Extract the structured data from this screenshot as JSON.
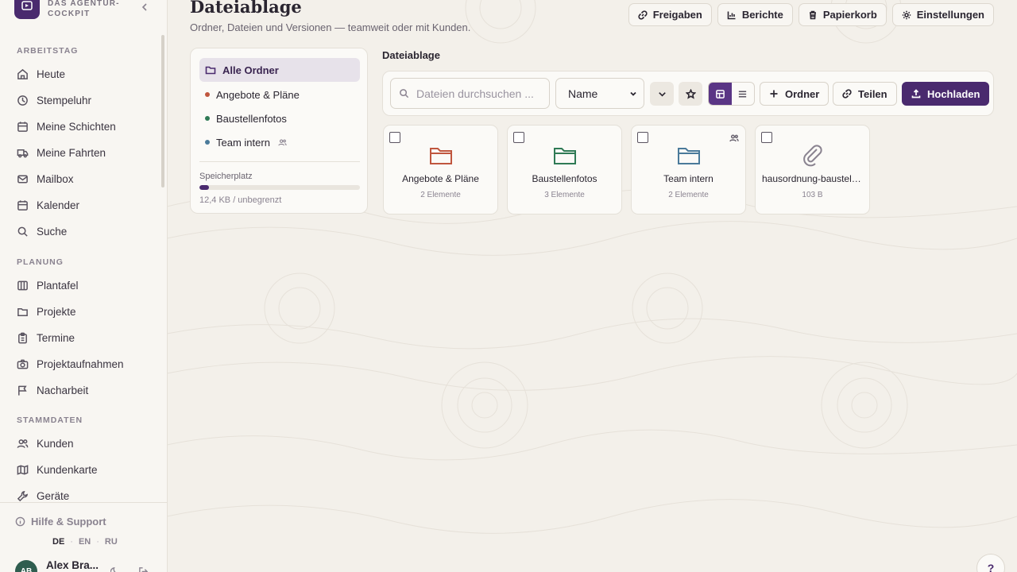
{
  "brand": {
    "tagline": "DAS AGENTUR-COCKPIT"
  },
  "sidebar": {
    "sections": [
      {
        "title": "ARBEITSTAG",
        "items": [
          {
            "label": "Heute",
            "icon": "home-icon"
          },
          {
            "label": "Stempeluhr",
            "icon": "clock-icon"
          },
          {
            "label": "Meine Schichten",
            "icon": "calendar-icon"
          },
          {
            "label": "Meine Fahrten",
            "icon": "truck-icon"
          },
          {
            "label": "Mailbox",
            "icon": "mail-icon"
          },
          {
            "label": "Kalender",
            "icon": "calendar-icon"
          },
          {
            "label": "Suche",
            "icon": "search-icon"
          }
        ]
      },
      {
        "title": "PLANUNG",
        "items": [
          {
            "label": "Plantafel",
            "icon": "board-icon"
          },
          {
            "label": "Projekte",
            "icon": "folder-icon"
          },
          {
            "label": "Termine",
            "icon": "clipboard-icon"
          },
          {
            "label": "Projektaufnahmen",
            "icon": "camera-icon"
          },
          {
            "label": "Nacharbeit",
            "icon": "flag-icon"
          }
        ]
      },
      {
        "title": "STAMMDATEN",
        "items": [
          {
            "label": "Kunden",
            "icon": "users-icon"
          },
          {
            "label": "Kundenkarte",
            "icon": "map-icon"
          },
          {
            "label": "Geräte",
            "icon": "wrench-icon"
          }
        ]
      }
    ],
    "help": "Hilfe & Support",
    "languages": [
      "DE",
      "EN",
      "RU"
    ],
    "active_language": "DE",
    "user": {
      "initials": "AB",
      "name": "Alex Bra..."
    }
  },
  "header": {
    "title": "Dateiablage",
    "subtitle": "Ordner, Dateien und Versionen — teamweit oder mit Kunden.",
    "actions": [
      "Freigaben",
      "Berichte",
      "Papierkorb",
      "Einstellungen"
    ]
  },
  "folders": {
    "all": "Alle Ordner",
    "items": [
      {
        "label": "Angebote & Pläne",
        "color": "#c0563e"
      },
      {
        "label": "Baustellenfotos",
        "color": "#2f7a55"
      },
      {
        "label": "Team intern",
        "color": "#4a7a9a",
        "shared": true
      }
    ],
    "storage_label": "Speicherplatz",
    "storage_text": "12,4 KB / unbegrenzt",
    "storage_fraction": 0.06
  },
  "main": {
    "section_title": "Dateiablage",
    "search_placeholder": "Dateien durchsuchen ...",
    "sort_value": "Name",
    "buttons": {
      "folder": "Ordner",
      "share": "Teilen",
      "upload": "Hochladen"
    },
    "cards": [
      {
        "name": "Angebote & Pläne",
        "meta": "2 Elemente",
        "type": "folder",
        "color": "#c0563e",
        "shared": false
      },
      {
        "name": "Baustellenfotos",
        "meta": "3 Elemente",
        "type": "folder",
        "color": "#2f7a55",
        "shared": false
      },
      {
        "name": "Team intern",
        "meta": "2 Elemente",
        "type": "folder",
        "color": "#4a7a9a",
        "shared": true
      },
      {
        "name": "hausordnung-baustelle...",
        "meta": "103 B",
        "type": "file",
        "color": "#8a8390",
        "shared": false
      }
    ]
  },
  "help_fab": "?"
}
